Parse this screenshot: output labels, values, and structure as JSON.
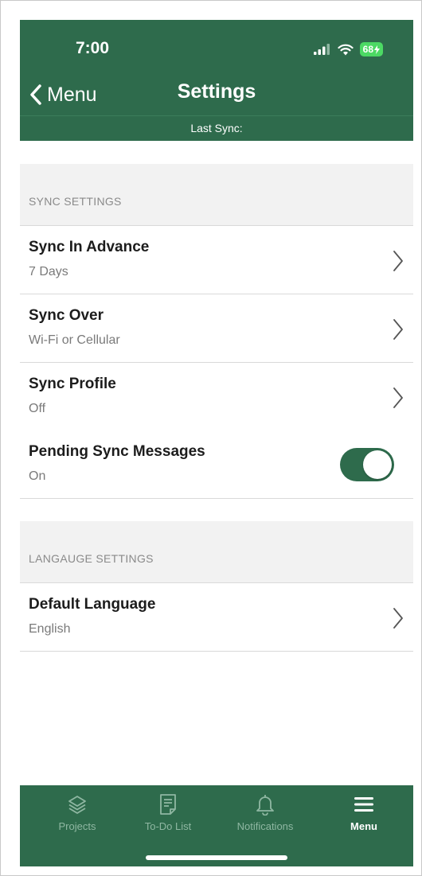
{
  "status_bar": {
    "time": "7:00",
    "battery": "68"
  },
  "nav": {
    "back_label": "Menu",
    "title": "Settings",
    "last_sync": "Last Sync:"
  },
  "sections": [
    {
      "header": "SYNC SETTINGS",
      "rows": [
        {
          "title": "Sync In Advance",
          "value": "7 Days",
          "control": "chevron"
        },
        {
          "title": "Sync Over",
          "value": "Wi-Fi or Cellular",
          "control": "chevron"
        },
        {
          "title": "Sync Profile",
          "value": "Off",
          "control": "chevron"
        },
        {
          "title": "Pending Sync Messages",
          "value": "On",
          "control": "toggle",
          "toggle_on": true
        }
      ]
    },
    {
      "header": "LANGAUGE SETTINGS",
      "rows": [
        {
          "title": "Default Language",
          "value": "English",
          "control": "chevron"
        }
      ]
    }
  ],
  "tab_bar": {
    "tabs": [
      {
        "label": "Projects",
        "icon": "layers-icon",
        "active": false
      },
      {
        "label": "To-Do List",
        "icon": "document-list-icon",
        "active": false
      },
      {
        "label": "Notifications",
        "icon": "bell-icon",
        "active": false
      },
      {
        "label": "Menu",
        "icon": "hamburger-menu-icon",
        "active": true
      }
    ]
  },
  "colors": {
    "brand_green": "#2e6b4c",
    "section_bg": "#f2f2f2",
    "inactive_tab": "#8fb7a2"
  }
}
